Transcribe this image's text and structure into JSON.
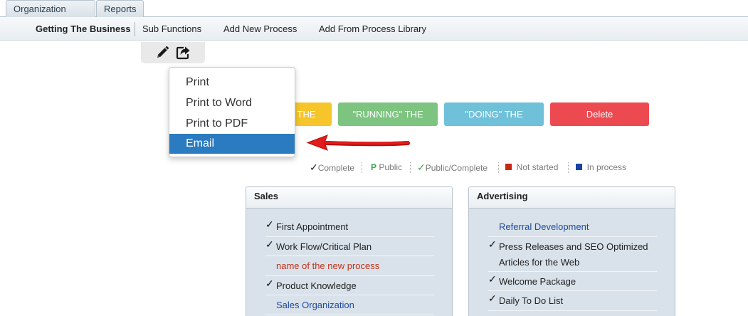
{
  "tabs": [
    "Organization Chart",
    "Reports"
  ],
  "subnav": {
    "items": [
      "Getting The Business",
      "Sub Functions",
      "Add New Process",
      "Add From Process Library"
    ]
  },
  "toolbar": {
    "icons": [
      "pencil-icon",
      "share-icon"
    ]
  },
  "buttons": {
    "b1": "THE",
    "b2": "\"RUNNING\" THE",
    "b3": "\"DOING\" THE",
    "b4": "Delete"
  },
  "dropdown": {
    "items": [
      "Print",
      "Print to Word",
      "Print to PDF",
      "Email"
    ],
    "selected": "Email"
  },
  "legend": {
    "complete": "Complete",
    "public_mark": "P",
    "public": "Public",
    "public_complete": "Public/Complete",
    "not_started": "Not started",
    "in_process": "In process"
  },
  "colors": {
    "yellow": "#f5c52b",
    "green": "#7cc47f",
    "teal": "#6ec1d9",
    "red": "#ec4a50",
    "selected_blue": "#2a7bbf",
    "arrow_red": "#e21c1c"
  },
  "panels": {
    "sales": {
      "title": "Sales",
      "items": [
        {
          "label": "First Appointment",
          "status": "complete"
        },
        {
          "label": "Work Flow/Critical Plan",
          "status": "complete"
        },
        {
          "label": "name of the new process",
          "status": "not-started"
        },
        {
          "label": "Product Knowledge",
          "status": "complete"
        },
        {
          "label": "Sales Organization",
          "status": "in-process"
        }
      ]
    },
    "advertising": {
      "title": "Advertising",
      "items": [
        {
          "label": "Referral Development",
          "status": "in-process"
        },
        {
          "label": "Press Releases and SEO Optimized Articles for the Web",
          "status": "complete"
        },
        {
          "label": "Welcome Package",
          "status": "complete"
        },
        {
          "label": "Daily To Do List",
          "status": "complete"
        }
      ]
    }
  }
}
